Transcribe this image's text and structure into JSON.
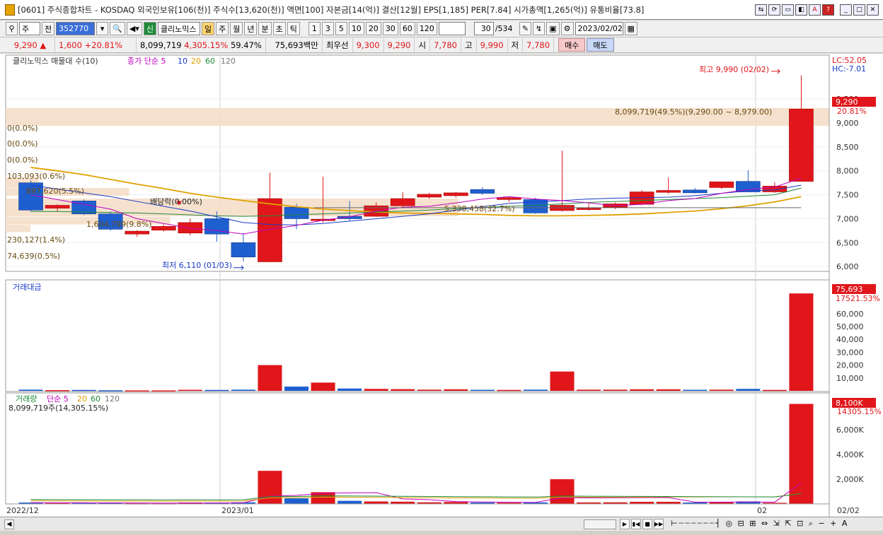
{
  "window": {
    "title": "[0601] 주식종합차트 - KOSDAQ 외국인보유[106(천)] 주식수[13,620(천)] 액면[100] 자본금[14(억)] 결산[12월] EPS[1,185] PER[7.84] 시가총액[1,265(억)] 유통비율[73.8]"
  },
  "toolbar": {
    "type_select": "주",
    "prev_label": "전",
    "code_value": "352770",
    "credit_label": "신",
    "stock_name": "클리노믹스",
    "periods": [
      "일",
      "주",
      "월",
      "년",
      "분",
      "초",
      "틱"
    ],
    "active_period": "일",
    "intervals": [
      "1",
      "3",
      "5",
      "10",
      "20",
      "30",
      "60",
      "120"
    ],
    "count_value": "30",
    "count_total": "/534",
    "date_value": "2023/02/02"
  },
  "quote": {
    "price": "9,290",
    "arrow": "▲",
    "change": "1,600",
    "rate": "+20.81%",
    "volume": "8,099,719",
    "volume_rate": "4,305.15%",
    "turnover": "59.47%",
    "amount": "75,693백만",
    "best_ask_label": "최우선",
    "best_ask": "9,300",
    "best_bid": "9,290",
    "open_label": "시",
    "open": "7,780",
    "high_label": "고",
    "high": "9,990",
    "low_label": "저",
    "low": "7,780",
    "buy_label": "매수",
    "sell_label": "매도"
  },
  "panels": {
    "price_legend": [
      "클리노믹스 매물대 수(10)",
      "종가 단순 5",
      "10",
      "20",
      "60",
      "120"
    ],
    "amount_legend": "거래대금",
    "volume_legend": [
      "거래량",
      "단순 5",
      "20",
      "60",
      "120"
    ],
    "volume_info": "8,099,719주(14,305.15%)",
    "right_lc": "LC:52.05",
    "right_hc": "HC:-7.01",
    "price_badge": "9,290",
    "price_badge_rate": "20.81%",
    "amount_badge": "75,693",
    "amount_badge_rate": "17521.53%",
    "volume_badge": "8,100K",
    "volume_badge_rate": "14305.15%",
    "high_marker": "최고 9,990 (02/02)",
    "low_marker": "최저 6,110 (01/03)",
    "dividend_marker": "배당락(0.00%)",
    "profile_labels": [
      "8,099,719(49.5%)(9,290.00 ~ 8,979.00)",
      "0(0.0%)",
      "0(0.0%)",
      "0(0.0%)",
      "103,093(0.6%)",
      "897,620(5.5%)",
      "1,604,799(9.8%)",
      "230,127(1.4%)",
      "74,639(0.5%)",
      "5,338,458(32.7%)"
    ],
    "x_labels": [
      "2022/12",
      "2023/01",
      "02",
      "02/02"
    ]
  },
  "chart_data": {
    "type": "candlestick",
    "price_axis": {
      "ticks": [
        6000,
        6500,
        7000,
        7500,
        8000,
        8500,
        9000,
        9500
      ],
      "labels": [
        "6,000",
        "6,500",
        "7,000",
        "7,500",
        "8,000",
        "8,500",
        "9,000",
        "9,500"
      ]
    },
    "amount_axis": {
      "ticks": [
        10000,
        20000,
        30000,
        40000,
        50000,
        60000
      ],
      "labels": [
        "10,000",
        "20,000",
        "30,000",
        "40,000",
        "50,000",
        "60,000"
      ]
    },
    "volume_axis": {
      "ticks": [
        2000,
        4000,
        6000
      ],
      "labels": [
        "2,000K",
        "4,000K",
        "6,000K"
      ]
    },
    "candles": [
      {
        "o": 7750,
        "h": 7800,
        "l": 7150,
        "c": 7180
      },
      {
        "o": 7220,
        "h": 7300,
        "l": 7150,
        "c": 7280
      },
      {
        "o": 7370,
        "h": 7400,
        "l": 7080,
        "c": 7100
      },
      {
        "o": 7100,
        "h": 7150,
        "l": 6750,
        "c": 6780
      },
      {
        "o": 6680,
        "h": 6760,
        "l": 6620,
        "c": 6740
      },
      {
        "o": 6760,
        "h": 6880,
        "l": 6730,
        "c": 6840
      },
      {
        "o": 6700,
        "h": 7000,
        "l": 6650,
        "c": 6920
      },
      {
        "o": 7000,
        "h": 7150,
        "l": 6520,
        "c": 6680
      },
      {
        "o": 6500,
        "h": 6700,
        "l": 6110,
        "c": 6200
      },
      {
        "o": 6100,
        "h": 7960,
        "l": 6090,
        "c": 7420
      },
      {
        "o": 7240,
        "h": 7310,
        "l": 6780,
        "c": 7000
      },
      {
        "o": 6960,
        "h": 7880,
        "l": 6920,
        "c": 6990
      },
      {
        "o": 7050,
        "h": 7370,
        "l": 6960,
        "c": 7000
      },
      {
        "o": 7050,
        "h": 7340,
        "l": 7040,
        "c": 7270
      },
      {
        "o": 7270,
        "h": 7550,
        "l": 7220,
        "c": 7420
      },
      {
        "o": 7450,
        "h": 7540,
        "l": 7420,
        "c": 7510
      },
      {
        "o": 7480,
        "h": 7560,
        "l": 7440,
        "c": 7540
      },
      {
        "o": 7610,
        "h": 7660,
        "l": 7500,
        "c": 7530
      },
      {
        "o": 7400,
        "h": 7450,
        "l": 7350,
        "c": 7440
      },
      {
        "o": 7400,
        "h": 7440,
        "l": 7100,
        "c": 7120
      },
      {
        "o": 7170,
        "h": 8420,
        "l": 7150,
        "c": 7280
      },
      {
        "o": 7190,
        "h": 7310,
        "l": 7170,
        "c": 7220
      },
      {
        "o": 7240,
        "h": 7340,
        "l": 7200,
        "c": 7310
      },
      {
        "o": 7300,
        "h": 7600,
        "l": 7280,
        "c": 7560
      },
      {
        "o": 7550,
        "h": 7860,
        "l": 7520,
        "c": 7590
      },
      {
        "o": 7600,
        "h": 7640,
        "l": 7530,
        "c": 7540
      },
      {
        "o": 7650,
        "h": 7770,
        "l": 7620,
        "c": 7770
      },
      {
        "o": 7780,
        "h": 8010,
        "l": 7560,
        "c": 7560
      },
      {
        "o": 7560,
        "h": 7760,
        "l": 7540,
        "c": 7680
      },
      {
        "o": 7780,
        "h": 9990,
        "l": 7780,
        "c": 9290
      }
    ],
    "amount": [
      900,
      500,
      700,
      400,
      300,
      300,
      800,
      700,
      900,
      20000,
      3300,
      6400,
      1800,
      1500,
      1300,
      900,
      1200,
      800,
      700,
      900,
      15000,
      900,
      900,
      1200,
      1200,
      800,
      900,
      1500,
      700,
      75693
    ],
    "volume": [
      110,
      70,
      90,
      60,
      50,
      50,
      110,
      100,
      130,
      2680,
      450,
      950,
      250,
      200,
      180,
      130,
      160,
      110,
      100,
      120,
      2000,
      120,
      130,
      170,
      170,
      110,
      120,
      200,
      90,
      8100
    ],
    "profile_bands": [
      {
        "lo": 8940,
        "hi": 9310,
        "width": 1.0
      },
      {
        "lo": 7650,
        "hi": 7860,
        "width": 0.04
      },
      {
        "lo": 7480,
        "hi": 7640,
        "width": 0.15
      },
      {
        "lo": 7050,
        "hi": 7420,
        "width": 0.55
      },
      {
        "lo": 6880,
        "hi": 7040,
        "width": 0.2
      },
      {
        "lo": 6720,
        "hi": 6870,
        "width": 0.03
      }
    ],
    "ma5": [
      7500,
      7400,
      7300,
      7200,
      7000,
      6900,
      6800,
      6750,
      6680,
      6780,
      6860,
      6970,
      7040,
      7160,
      7240,
      7260,
      7330,
      7410,
      7460,
      7410,
      7380,
      7330,
      7270,
      7300,
      7380,
      7420,
      7530,
      7610,
      7660,
      7850
    ],
    "ma10": [
      7700,
      7620,
      7540,
      7460,
      7360,
      7260,
      7160,
      7040,
      6920,
      6880,
      6870,
      6900,
      6950,
      7000,
      7050,
      7100,
      7180,
      7250,
      7320,
      7350,
      7380,
      7410,
      7430,
      7440,
      7450,
      7480,
      7530,
      7580,
      7600,
      7700
    ],
    "ma20": [
      7150,
      7150,
      7140,
      7130,
      7120,
      7100,
      7080,
      7060,
      7050,
      7060,
      7080,
      7100,
      7120,
      7140,
      7160,
      7180,
      7210,
      7230,
      7260,
      7280,
      7310,
      7340,
      7360,
      7380,
      7400,
      7420,
      7440,
      7470,
      7500,
      7640
    ],
    "ma60": [
      8070,
      8000,
      7920,
      7820,
      7720,
      7630,
      7530,
      7450,
      7380,
      7310,
      7250,
      7200,
      7170,
      7140,
      7120,
      7110,
      7100,
      7090,
      7070,
      7060,
      7060,
      7070,
      7080,
      7100,
      7130,
      7160,
      7210,
      7270,
      7350,
      7460
    ]
  }
}
